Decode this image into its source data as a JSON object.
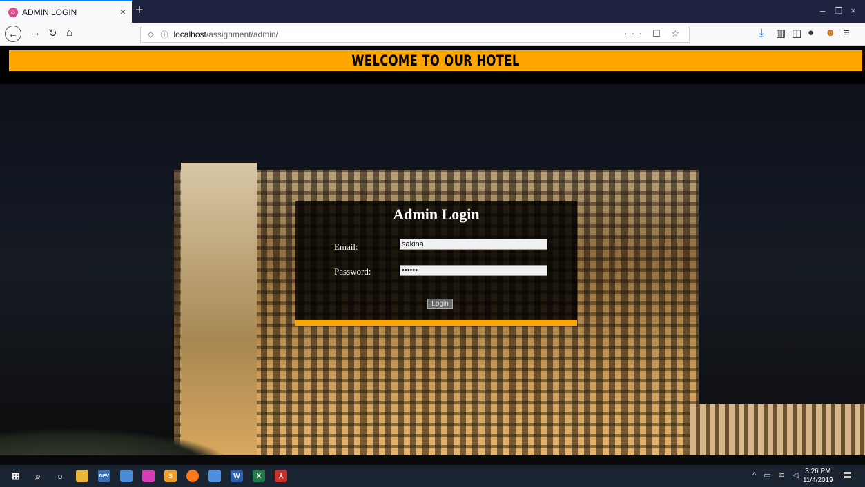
{
  "browser": {
    "tab_title": "ADMIN LOGIN",
    "tab_close": "×",
    "new_tab": "+",
    "url_host": "localhost",
    "url_path": "/assignment/admin/",
    "url_actions": "··· ☐ ☆",
    "window_controls": [
      "–",
      "❐",
      "×"
    ],
    "toolbar_icons": [
      "download-icon",
      "library-icon",
      "sidebar-icon",
      "extension-icon",
      "profile-icon",
      "menu-icon"
    ]
  },
  "page": {
    "banner": "WELCOME TO OUR HOTEL",
    "login": {
      "title": "Admin Login",
      "email_label": "Email:",
      "email_value": "sakina",
      "password_label": "Password:",
      "password_value": "••••••",
      "button_label": "Login"
    },
    "accent_color": "#ffa500"
  },
  "taskbar": {
    "apps": [
      "windows-icon",
      "search-icon",
      "cortana-icon",
      "file-explorer-icon",
      "devc-icon",
      "notepad-icon",
      "app-icon",
      "sublime-icon",
      "firefox-icon",
      "app2-icon",
      "word-icon",
      "excel-icon",
      "acrobat-icon"
    ],
    "time": "3:26 PM",
    "date": "11/4/2019"
  }
}
